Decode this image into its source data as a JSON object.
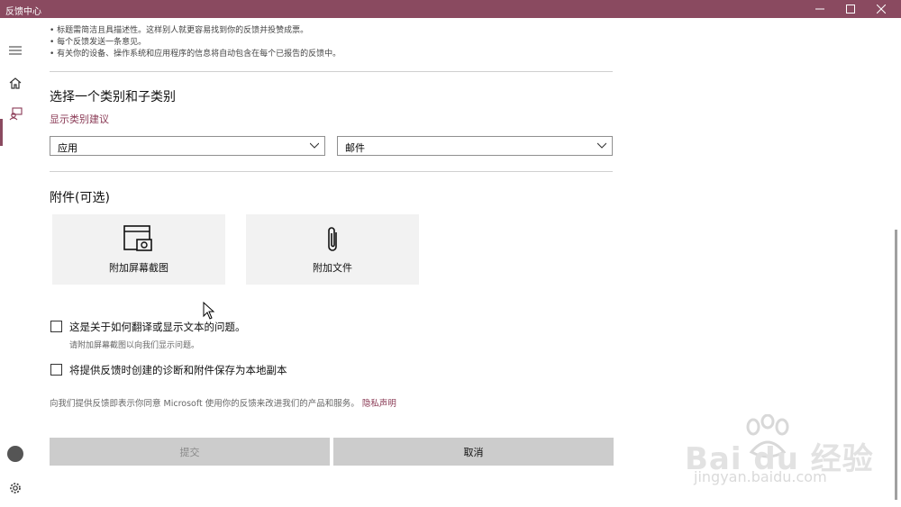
{
  "window": {
    "title": "反馈中心"
  },
  "content": {
    "bullets": [
      "• 标题需简洁且具描述性。这样别人就更容易找到你的反馈并投赞成票。",
      "• 每个反馈发送一条意见。",
      "• 有关你的设备、操作系统和应用程序的信息将自动包含在每个已报告的反馈中。"
    ],
    "category": {
      "title": "选择一个类别和子类别",
      "suggestion_link": "显示类别建议",
      "category_value": "应用",
      "subcategory_value": "邮件"
    },
    "attachments": {
      "title": "附件(可选)",
      "screenshot_label": "附加屏幕截图",
      "file_label": "附加文件"
    },
    "checks": {
      "translate_label": "这是关于如何翻译或显示文本的问题。",
      "translate_note": "请附加屏幕截图以向我们显示问题。",
      "save_local_label": "将提供反馈时创建的诊断和附件保存为本地副本"
    },
    "consent": {
      "text": "向我们提供反馈即表示你同意 Microsoft 使用你的反馈来改进我们的产品和服务。",
      "privacy_link": "隐私声明"
    },
    "buttons": {
      "submit": "提交",
      "cancel": "取消"
    }
  },
  "watermark": {
    "brand": "Bai du 经验",
    "url": "jingyan.baidu.com"
  },
  "colors": {
    "accent": "#8a4a60",
    "link": "#8a3a55"
  }
}
